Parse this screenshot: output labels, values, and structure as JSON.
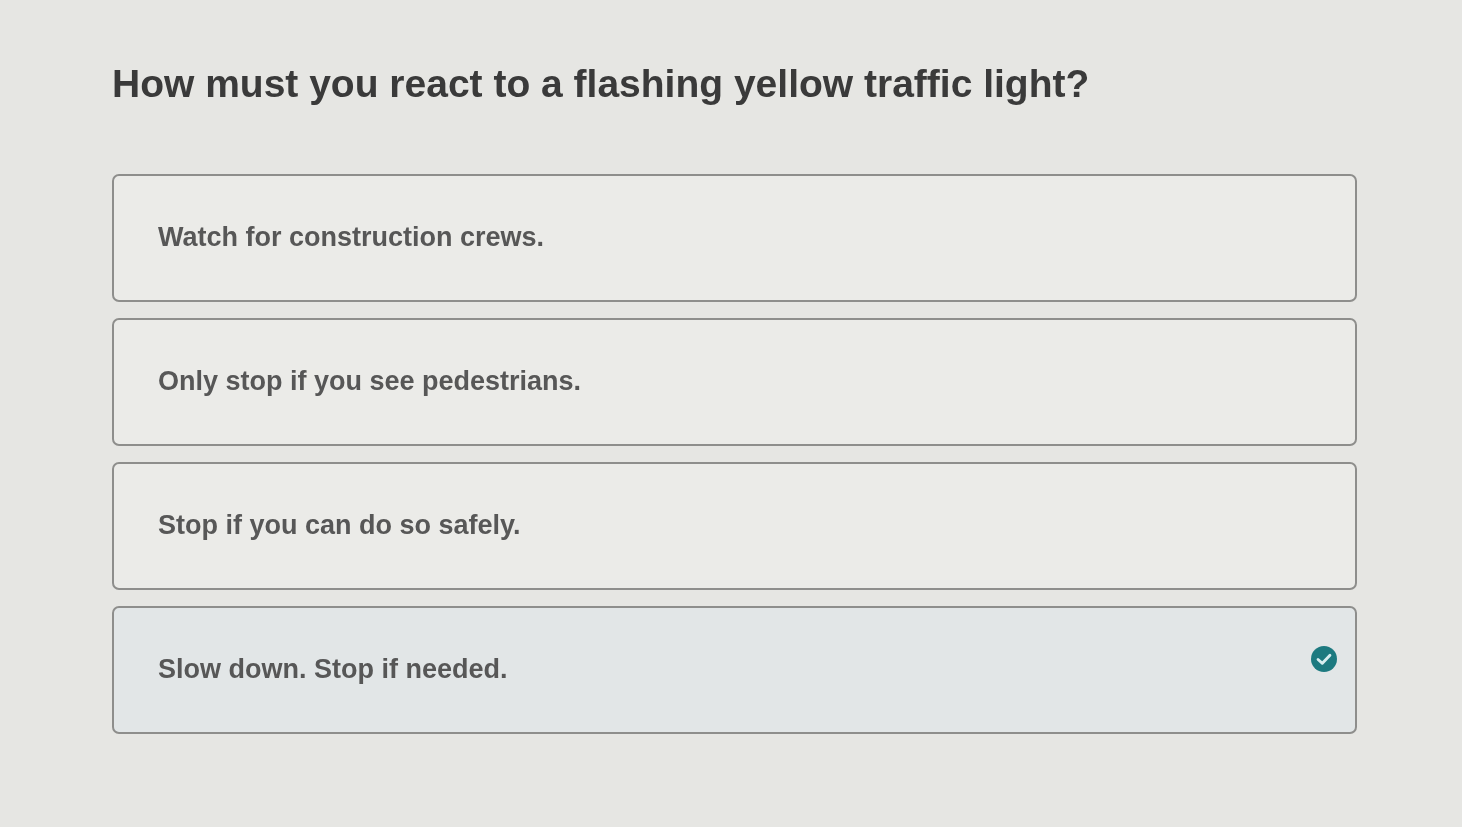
{
  "question": "How must you react to a flashing yellow traffic light?",
  "options": [
    {
      "text": "Watch for construction crews.",
      "selected": false
    },
    {
      "text": "Only stop if you see pedestrians.",
      "selected": false
    },
    {
      "text": "Stop if you can do so safely.",
      "selected": false
    },
    {
      "text": "Slow down. Stop if needed.",
      "selected": true
    }
  ]
}
